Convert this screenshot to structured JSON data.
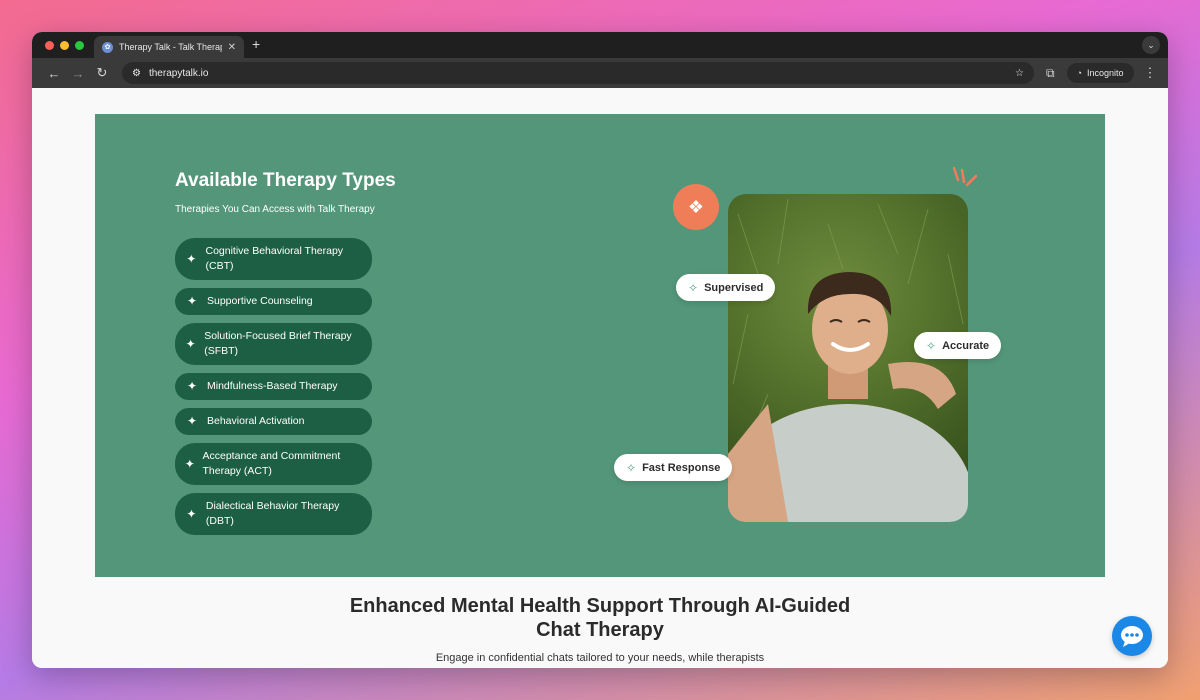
{
  "browser": {
    "tab_title": "Therapy Talk - Talk Therapy",
    "tab_close": "✕",
    "new_tab": "+",
    "url": "therapytalk.io",
    "incognito_label": "Incognito"
  },
  "hero": {
    "title": "Available Therapy Types",
    "subtitle": "Therapies You Can Access with Talk Therapy",
    "therapies": [
      "Cognitive Behavioral Therapy (CBT)",
      "Supportive Counseling",
      "Solution-Focused Brief Therapy (SFBT)",
      "Mindfulness-Based Therapy",
      "Behavioral Activation",
      "Acceptance and Commitment Therapy (ACT)",
      "Dialectical Behavior Therapy (DBT)"
    ],
    "badges": {
      "supervised": "Supervised",
      "accurate": "Accurate",
      "fast_response": "Fast Response"
    },
    "accent_color": "#53967a",
    "pill_color": "#1d5f45",
    "logo_color": "#ef7e58"
  },
  "section": {
    "title_line1": "Enhanced Mental Health Support Through AI-Guided",
    "title_line2": "Chat Therapy",
    "subtitle": "Engage in confidential chats tailored to your needs, while therapists"
  },
  "icons": {
    "chat": "chat-bubble-icon",
    "sparkle": "sparkle-icon"
  }
}
